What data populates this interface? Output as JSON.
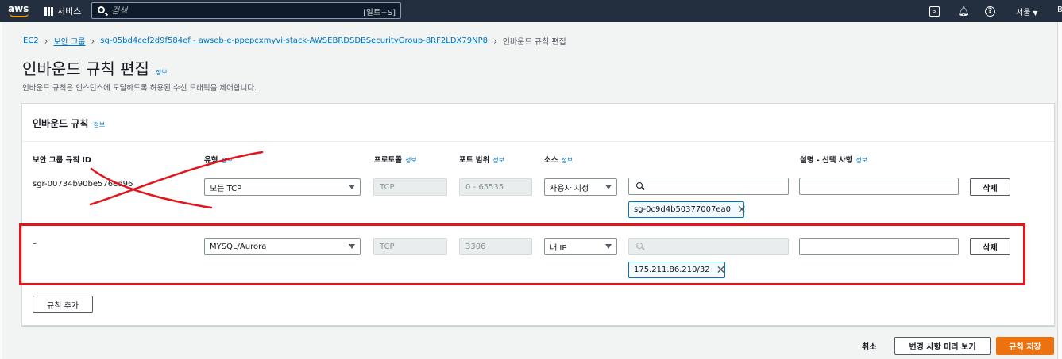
{
  "colors": {
    "nav_bg": "#232f3e",
    "accent": "#ff9900",
    "primary_btn": "#ec7211",
    "link": "#0073bb",
    "annotation": "#e1161d"
  },
  "topnav": {
    "logo": "aws",
    "services_label": "서비스",
    "search_placeholder": "검색",
    "search_shortcut": "[알트+S]",
    "icons": [
      "cloudshell-icon",
      "bell-icon",
      "help-icon"
    ],
    "region_label": "서울",
    "edge_text": "B"
  },
  "breadcrumb": {
    "items": [
      "EC2",
      "보안 그룹",
      "sg-05bd4cef2d9f584ef - awseb-e-ppepcxmyvi-stack-AWSEBRDSDBSecurityGroup-8RF2LDX79NP8"
    ],
    "current": "인바운드 규칙 편집"
  },
  "page": {
    "title": "인바운드 규칙 편집",
    "info": "정보",
    "description": "인바운드 규칙은 인스턴스에 도달하도록 허용된 수신 트래픽을 제어합니다."
  },
  "panel": {
    "title": "인바운드 규칙",
    "info": "정보",
    "columns": {
      "rule_id": "보안 그룹 규칙 ID",
      "type": "유형",
      "protocol": "프로토콜",
      "port_range": "포트 범위",
      "source": "소스",
      "description": "설명 - 선택 사항"
    },
    "rows": [
      {
        "rule_id": "sgr-00734b90be576ed96",
        "type": "모든 TCP",
        "protocol": "TCP",
        "port_range": "0 - 65535",
        "source_type": "사용자 지정",
        "source_search": "",
        "token": "sg-0c9d4b50377007ea0",
        "description": "",
        "delete": "삭제"
      },
      {
        "rule_id": "–",
        "type": "MYSQL/Aurora",
        "protocol": "TCP",
        "port_range": "3306",
        "source_type": "내 IP",
        "source_search": "",
        "token": "175.211.86.210/32",
        "description": "",
        "delete": "삭제"
      }
    ],
    "add_rule": "규칙 추가"
  },
  "footer": {
    "cancel": "취소",
    "preview": "변경 사항 미리 보기",
    "save": "규칙 저장"
  }
}
